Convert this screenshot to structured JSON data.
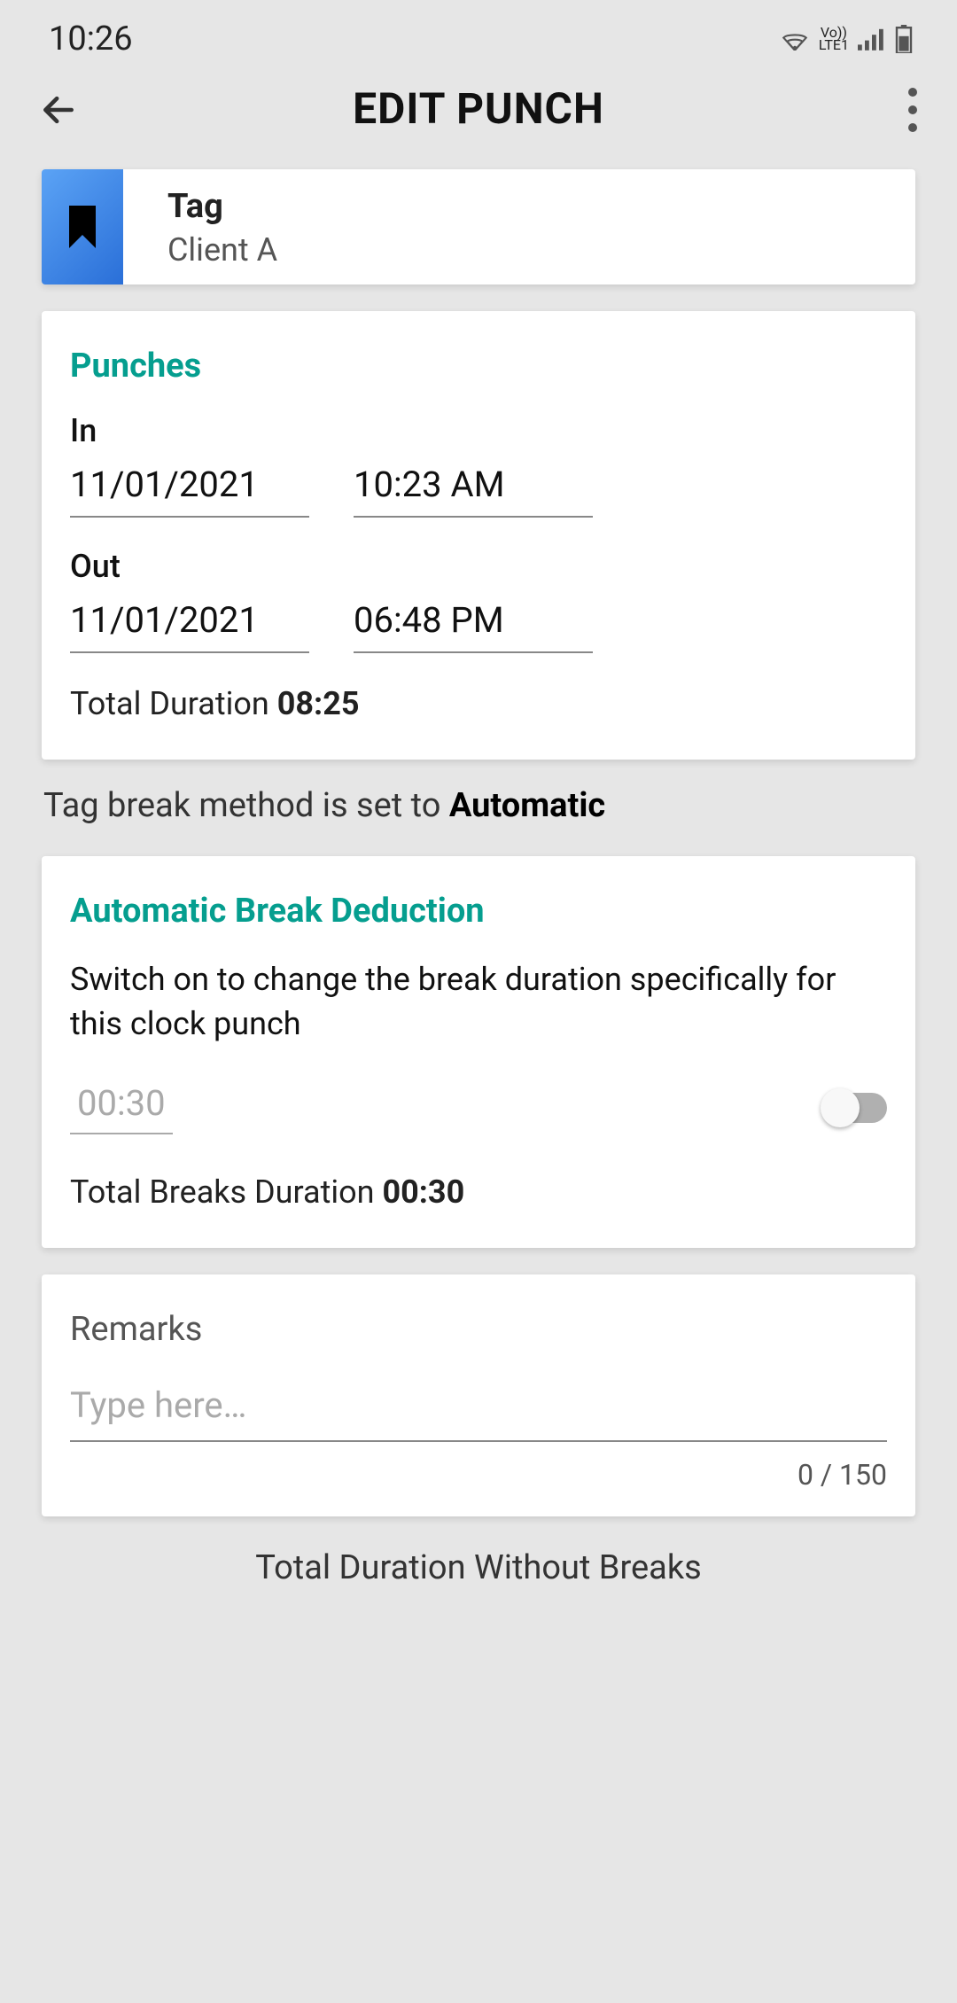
{
  "status_bar": {
    "time": "10:26",
    "network_label": "Vo))",
    "network_label2": "LTE1"
  },
  "header": {
    "title": "EDIT PUNCH"
  },
  "tag": {
    "label": "Tag",
    "value": "Client A"
  },
  "punches": {
    "title": "Punches",
    "in_label": "In",
    "in_date": "11/01/2021",
    "in_time": "10:23 AM",
    "out_label": "Out",
    "out_date": "11/01/2021",
    "out_time": "06:48 PM",
    "total_label": "Total Duration",
    "total_value": "08:25"
  },
  "break_info": {
    "prefix": "Tag break method is set to",
    "mode": "Automatic"
  },
  "break_deduction": {
    "title": "Automatic Break Deduction",
    "description": "Switch on to change the break duration specifically for this clock punch",
    "input_value": "00:30",
    "toggle_on": false,
    "total_label": "Total Breaks Duration",
    "total_value": "00:30"
  },
  "remarks": {
    "title": "Remarks",
    "placeholder": "Type here…",
    "counter": "0 / 150"
  },
  "bottom": {
    "label": "Total Duration Without Breaks"
  }
}
